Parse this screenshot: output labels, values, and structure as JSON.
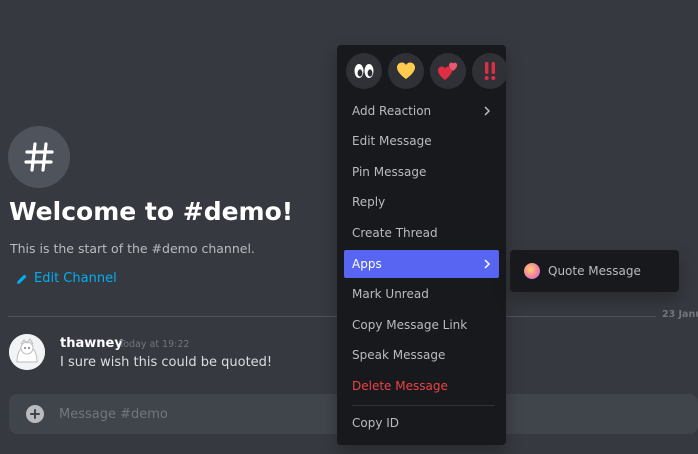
{
  "channel": {
    "welcome_title": "Welcome to #demo!",
    "welcome_description": "This is the start of the #demo channel.",
    "edit_channel_label": "Edit Channel",
    "date_divider": "23 Janu"
  },
  "message": {
    "author": "thawney",
    "timestamp": "Today at 19:22",
    "content": "I sure wish this could be quoted!"
  },
  "composer": {
    "placeholder": "Message #demo"
  },
  "context_menu": {
    "quick_reactions": [
      "eyes-emoji",
      "yellow-heart-emoji",
      "two-hearts-emoji",
      "double-exclamation-emoji"
    ],
    "items": [
      {
        "label": "Add Reaction",
        "has_submenu": true
      },
      {
        "label": "Edit Message"
      },
      {
        "label": "Pin Message"
      },
      {
        "label": "Reply"
      },
      {
        "label": "Create Thread"
      },
      {
        "label": "Apps",
        "has_submenu": true,
        "active": true
      },
      {
        "label": "Mark Unread"
      },
      {
        "label": "Copy Message Link"
      },
      {
        "label": "Speak Message"
      },
      {
        "label": "Delete Message",
        "danger": true
      },
      {
        "label": "Copy ID"
      }
    ]
  },
  "apps_submenu": {
    "items": [
      {
        "label": "Quote Message",
        "icon": "quote-app-icon"
      }
    ]
  },
  "colors": {
    "background": "#36393f",
    "menu_background": "#18191c",
    "accent": "#5865f2",
    "danger": "#ed4245",
    "link": "#00aff4"
  }
}
